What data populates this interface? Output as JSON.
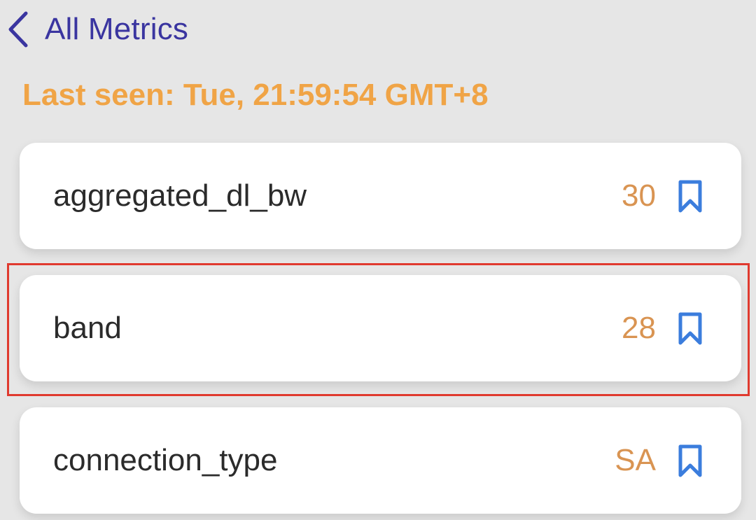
{
  "nav": {
    "back_label": "All Metrics",
    "back_icon": "chevron-left-icon"
  },
  "status": {
    "last_seen": "Last seen: Tue, 21:59:54 GMT+8"
  },
  "metrics": [
    {
      "name": "aggregated_dl_bw",
      "value": "30",
      "bookmark_icon": "bookmark-outline-icon"
    },
    {
      "name": "band",
      "value": "28",
      "bookmark_icon": "bookmark-outline-icon",
      "highlighted": true
    },
    {
      "name": "connection_type",
      "value": "SA",
      "bookmark_icon": "bookmark-outline-icon"
    }
  ],
  "colors": {
    "background": "#e6e6e6",
    "card": "#ffffff",
    "nav_accent": "#3a35a0",
    "last_seen": "#f0a446",
    "metric_value": "#d99452",
    "bookmark": "#3b7ddd",
    "highlight_border": "#e03a2f"
  }
}
